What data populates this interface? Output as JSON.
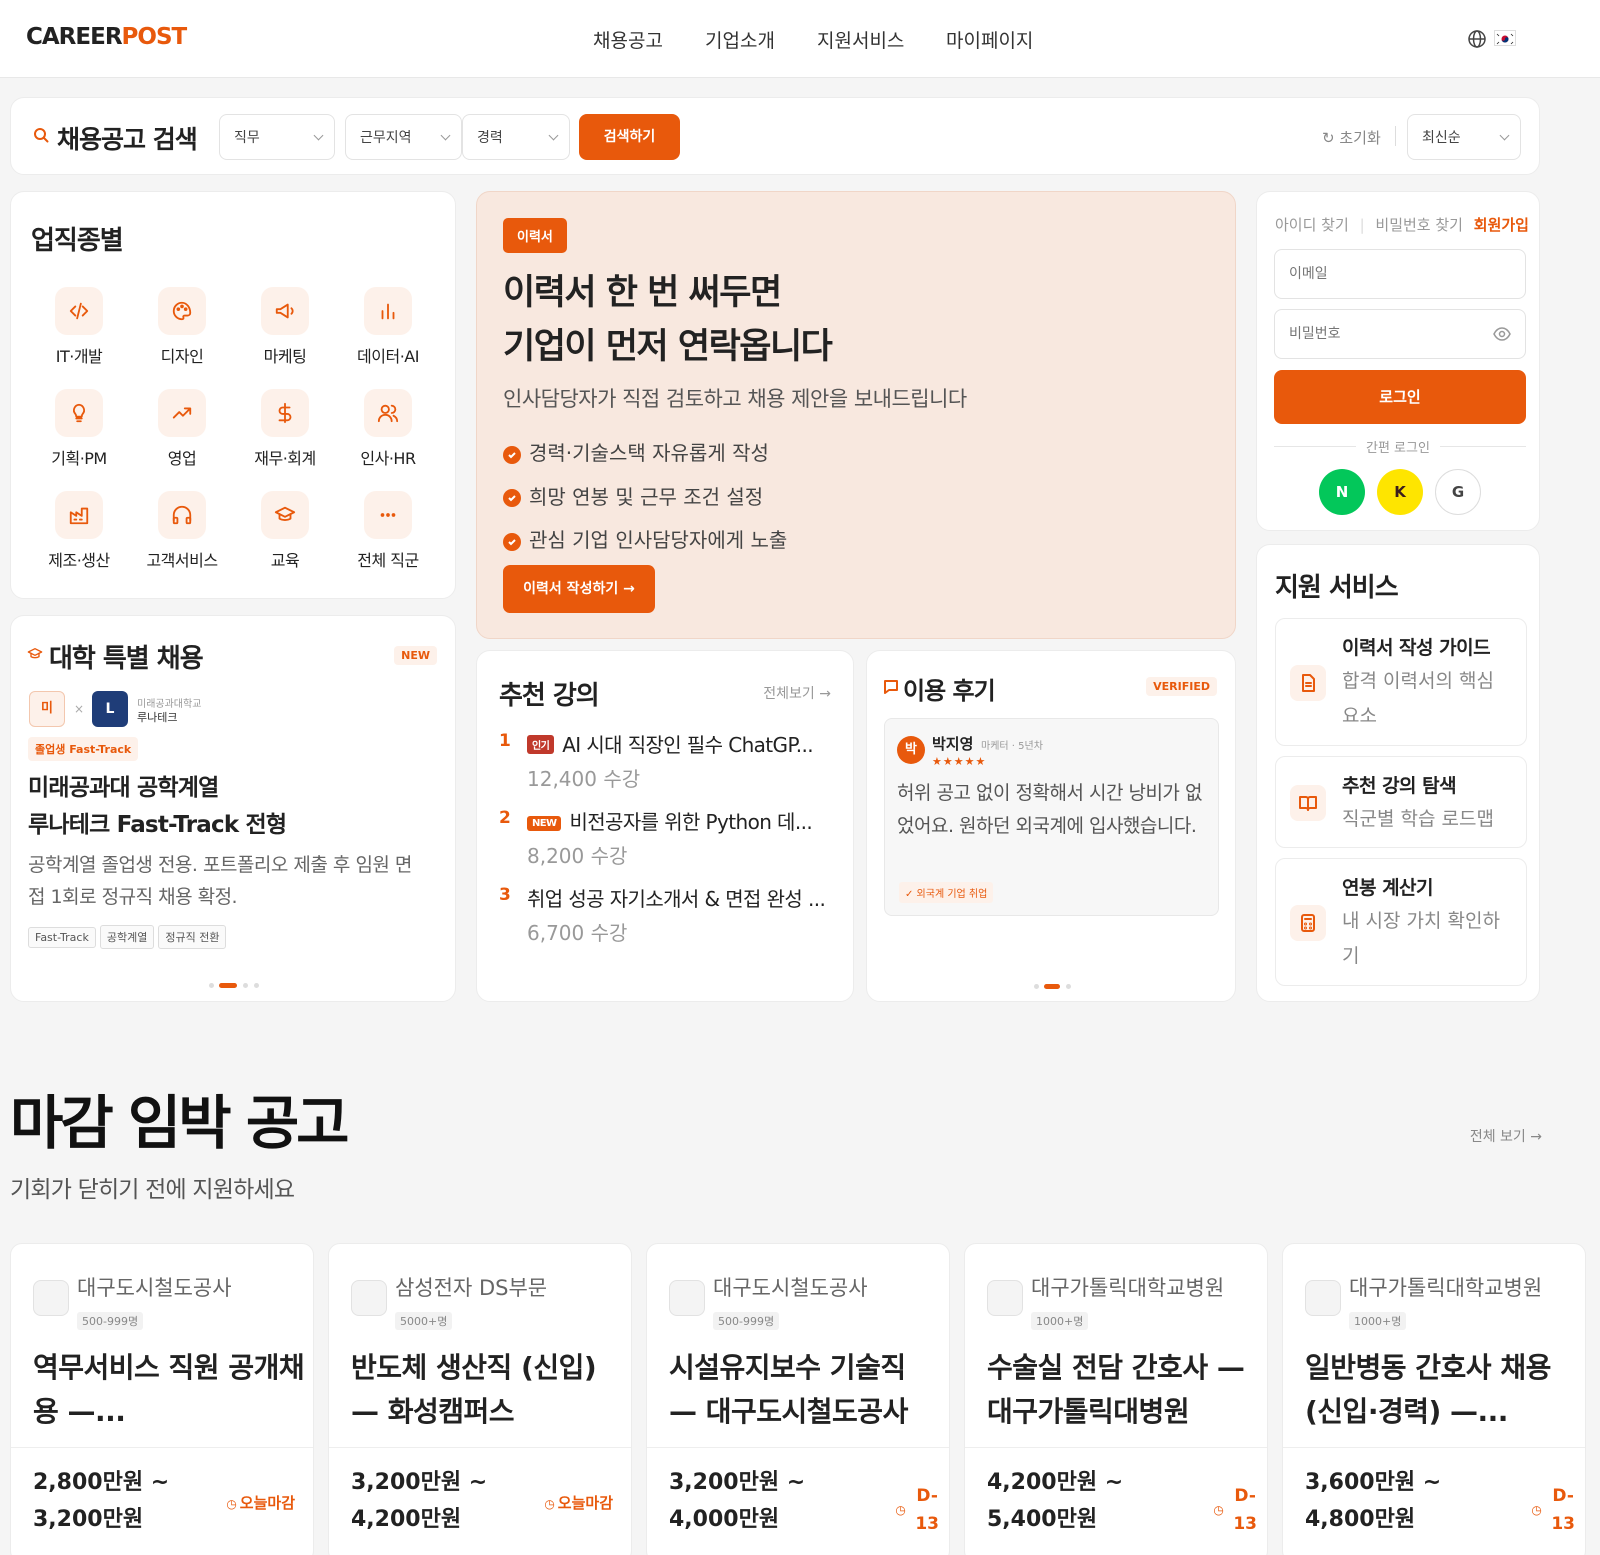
{
  "header": {
    "logo_a": "CAREER",
    "logo_b": "POST",
    "nav": [
      "채용공고",
      "기업소개",
      "지원서비스",
      "마이페이지"
    ]
  },
  "search": {
    "title": "채용공고 검색",
    "job_select": "직무",
    "region_select": "근무지역",
    "career_select": "경력",
    "button": "검색하기",
    "reset": "초기화",
    "sort": "최신순"
  },
  "categories": {
    "title": "업직종별",
    "items": [
      {
        "label": "IT·개발",
        "icon": "code-icon"
      },
      {
        "label": "디자인",
        "icon": "palette-icon"
      },
      {
        "label": "마케팅",
        "icon": "megaphone-icon"
      },
      {
        "label": "데이터·AI",
        "icon": "bar-chart-icon"
      },
      {
        "label": "기획·PM",
        "icon": "lightbulb-icon"
      },
      {
        "label": "영업",
        "icon": "trending-up-icon"
      },
      {
        "label": "재무·회계",
        "icon": "dollar-icon"
      },
      {
        "label": "인사·HR",
        "icon": "users-icon"
      },
      {
        "label": "제조·생산",
        "icon": "factory-icon"
      },
      {
        "label": "고객서비스",
        "icon": "headphones-icon"
      },
      {
        "label": "교육",
        "icon": "graduation-cap-icon"
      },
      {
        "label": "전체 직군",
        "icon": "more-icon"
      }
    ]
  },
  "hero": {
    "badge": "이력서",
    "title_line1": "이력서 한 번 써두면",
    "title_line2": "기업이 먼저 연락옵니다",
    "subtitle": "인사담당자가 직접 검토하고 채용 제안을 보내드립니다",
    "bullets": [
      "경력·기술스택 자유롭게 작성",
      "희망 연봉 및 근무 조건 설정",
      "관심 기업 인사담당자에게 노출"
    ],
    "button": "이력서 작성하기 →"
  },
  "login": {
    "find_id": "아이디 찾기",
    "find_pw": "비밀번호 찾기",
    "signup": "회원가입",
    "email_placeholder": "이메일",
    "pw_placeholder": "비밀번호",
    "button": "로그인",
    "social_label": "간편 로그인",
    "social": [
      {
        "letter": "N",
        "color": "#03c75a",
        "fg": "#ffffff"
      },
      {
        "letter": "K",
        "color": "#fee500",
        "fg": "#3a1d1d"
      },
      {
        "letter": "G",
        "color": "#ffffff",
        "fg": "#444444"
      }
    ]
  },
  "univ": {
    "title": "대학 특별 채용",
    "badge": "NEW",
    "logo1": "미",
    "times": "×",
    "logo2": "L",
    "partner_sub": "미래공과대학교",
    "partner_name": "루나테크",
    "track_tag": "졸업생 Fast-Track",
    "headline1": "미래공과대 공학계열",
    "headline2": "루나테크 Fast-Track 전형",
    "desc": "공학계열 졸업생 전용. 포트폴리오 제출 후 임원 면접 1회로 정규직 채용 확정.",
    "tags": [
      "Fast-Track",
      "공학계열",
      "정규직 전환"
    ]
  },
  "lectures": {
    "title": "추천 강의",
    "view_all": "전체보기 →",
    "items": [
      {
        "rank": "1",
        "badge": "인기",
        "title": "AI 시대 직장인 필수 ChatGP...",
        "count": "12,400 수강"
      },
      {
        "rank": "2",
        "badge": "NEW",
        "title": "비전공자를 위한 Python 데...",
        "count": "8,200 수강"
      },
      {
        "rank": "3",
        "badge": "",
        "title": "취업 성공 자기소개서 & 면접 완성 ...",
        "count": "6,700 수강"
      }
    ]
  },
  "reviews": {
    "title": "이용 후기",
    "badge": "VERIFIED",
    "avatar": "박",
    "name": "박지영",
    "meta": "마케터 · 5년차",
    "stars": "★★★★★",
    "rating": 5,
    "text": "허위 공고 없이 정확해서 시간 낭비가 없었어요. 원하던 외국계에 입사했습니다.",
    "tag": "✓ 외국계 기업 취업"
  },
  "services": {
    "title": "지원 서비스",
    "items": [
      {
        "title": "이력서 작성 가이드",
        "desc": "합격 이력서의 핵심 요소",
        "icon": "document-icon"
      },
      {
        "title": "추천 강의 탐색",
        "desc": "직군별 학습 로드맵",
        "icon": "book-icon"
      },
      {
        "title": "연봉 계산기",
        "desc": "내 시장 가치 확인하기",
        "icon": "calculator-icon"
      }
    ]
  },
  "deadline": {
    "title": "마감 임박 공고",
    "subtitle": "기회가 닫히기 전에 지원하세요",
    "view_all": "전체 보기 →",
    "jobs": [
      {
        "company": "대구도시철도공사",
        "size": "500-999명",
        "title": "역무서비스 직원 공개채용 —...",
        "salary1": "2,800만원 ~",
        "salary2": "3,200만원",
        "deadline": "오늘마감"
      },
      {
        "company": "삼성전자 DS부문",
        "size": "5000+명",
        "title": "반도체 생산직 (신입) — 화성캠퍼스",
        "salary1": "3,200만원 ~",
        "salary2": "4,200만원",
        "deadline": "오늘마감"
      },
      {
        "company": "대구도시철도공사",
        "size": "500-999명",
        "title": "시설유지보수 기술직 — 대구도시철도공사",
        "salary1": "3,200만원 ~",
        "salary2": "4,000만원",
        "deadline": "D-13"
      },
      {
        "company": "대구가톨릭대학교병원",
        "size": "1000+명",
        "title": "수술실 전담 간호사 — 대구가톨릭대병원",
        "salary1": "4,200만원 ~",
        "salary2": "5,400만원",
        "deadline": "D-13"
      },
      {
        "company": "대구가톨릭대학교병원",
        "size": "1000+명",
        "title": "일반병동 간호사 채용 (신입·경력) —...",
        "salary1": "3,600만원 ~",
        "salary2": "4,800만원",
        "deadline": "D-13"
      }
    ]
  },
  "colors": {
    "accent": "#e8590c",
    "hero_bg": "#f8e8df",
    "page_bg": "#f5f5f5"
  }
}
